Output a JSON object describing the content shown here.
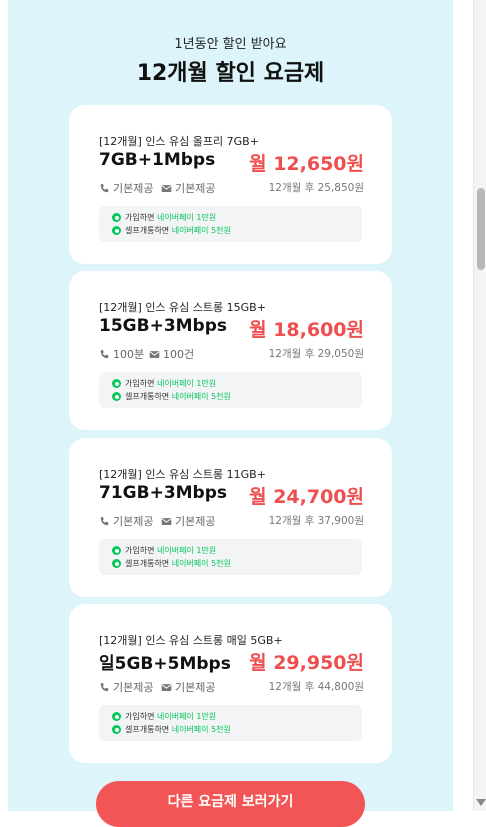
{
  "header": {
    "subtitle": "1년동안 할인 받아요",
    "title": "12개월 할인 요금제"
  },
  "plans": [
    {
      "name": "[12개월] 인스 유심 올프리 7GB+",
      "spec": "7GB+1Mbps",
      "price": "월 12,650원",
      "calls": "기본제공",
      "messages": "기본제공",
      "after_price": "12개월 후 25,850원",
      "benefit1_prefix": "가입하면 ",
      "benefit1_value": "네이버페이 1만원",
      "benefit2_prefix": "셀프개통하면 ",
      "benefit2_value": "네이버페이 5천원"
    },
    {
      "name": "[12개월] 인스 유심 스트롱 15GB+",
      "spec": "15GB+3Mbps",
      "price": "월 18,600원",
      "calls": "100분",
      "messages": "100건",
      "after_price": "12개월 후 29,050원",
      "benefit1_prefix": "가입하면 ",
      "benefit1_value": "네이버페이 1만원",
      "benefit2_prefix": "셀프개통하면 ",
      "benefit2_value": "네이버페이 5천원"
    },
    {
      "name": "[12개월] 인스 유심 스트롱 11GB+",
      "spec": "71GB+3Mbps",
      "price": "월 24,700원",
      "calls": "기본제공",
      "messages": "기본제공",
      "after_price": "12개월 후 37,900원",
      "benefit1_prefix": "가입하면 ",
      "benefit1_value": "네이버페이 1만원",
      "benefit2_prefix": "셀프개통하면 ",
      "benefit2_value": "네이버페이 5천원"
    },
    {
      "name": "[12개월] 인스 유심 스트롱 매일 5GB+",
      "spec": "일5GB+5Mbps",
      "price": "월 29,950원",
      "calls": "기본제공",
      "messages": "기본제공",
      "after_price": "12개월 후 44,800원",
      "benefit1_prefix": "가입하면 ",
      "benefit1_value": "네이버페이 1만원",
      "benefit2_prefix": "셀프개통하면 ",
      "benefit2_value": "네이버페이 5천원"
    }
  ],
  "cta": {
    "label": "다른 요금제 보러가기"
  },
  "colors": {
    "panel_bg": "#dcf4fa",
    "price": "#ef4f4f",
    "cta_bg": "#f25555",
    "naver_green": "#03c75a"
  },
  "icons": {
    "call": "phone-icon",
    "message": "envelope-icon",
    "benefit": "naverpay-icon",
    "scroll": "scroll-down-arrow-icon"
  }
}
